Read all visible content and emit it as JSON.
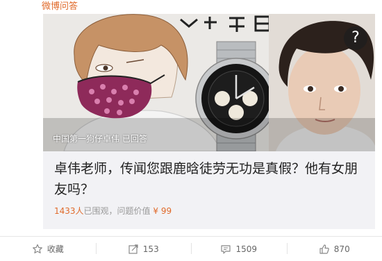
{
  "source": {
    "label": "微博问答"
  },
  "card": {
    "caption": "中国第一狗仔卓伟 已回答",
    "question_badge": "?",
    "title": "卓伟老师，传闻您跟鹿晗徒劳无功是真假？他有女朋友吗？",
    "watchers": "1433人",
    "watchers_suffix": "已围观，问题价值",
    "price": "¥ 99"
  },
  "actions": {
    "favorite": {
      "icon": "star-icon",
      "label": "收藏"
    },
    "share": {
      "icon": "share-icon",
      "count": "153"
    },
    "comment": {
      "icon": "comment-icon",
      "count": "1509"
    },
    "like": {
      "icon": "thumbs-up-icon",
      "count": "870"
    }
  },
  "colors": {
    "accent": "#e06a2a",
    "text": "#222222",
    "muted": "#999999",
    "card_bg": "#f2f2f5"
  }
}
